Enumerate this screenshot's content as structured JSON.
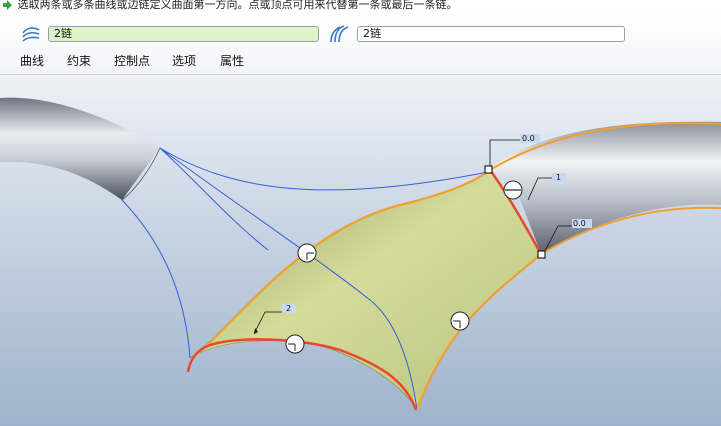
{
  "message": {
    "icon": "green-arrow-icon",
    "text": "选取两条或多条曲线或边链定义曲面第一方向。点或顶点可用来代替第一条或最后一条链。"
  },
  "dashboard": {
    "first_direction": {
      "icon": "first-direction-curves-icon",
      "value": "2链"
    },
    "second_direction": {
      "icon": "second-direction-curves-icon",
      "value": "2链"
    },
    "tabs": [
      "曲线",
      "约束",
      "控制点",
      "选项",
      "属性"
    ]
  },
  "viewport": {
    "labels": {
      "top_vertex": "0.0",
      "right_edge": "1",
      "bottom_vertex": "0.0",
      "left_edge": "2"
    },
    "colors": {
      "selected_chain": "#e8482e",
      "boundary_chain": "#f0a030",
      "surface": "#c5d08a",
      "curve": "#3a5fd6"
    }
  }
}
